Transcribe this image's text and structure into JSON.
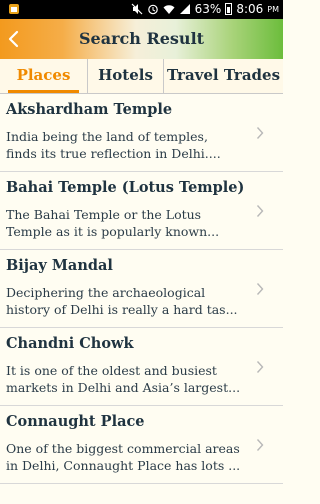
{
  "status_bar": {
    "battery": "63%",
    "time": "8:06",
    "ampm": "PM",
    "icons": [
      "notification-icon",
      "mute-icon",
      "alarm-icon",
      "wifi-icon",
      "signal-icon",
      "battery-icon"
    ]
  },
  "header": {
    "title": "Search Result",
    "back_icon": "chevron-left-icon",
    "gradient_colors": [
      "#f39a1e",
      "#ffffff",
      "#6cbd3c"
    ]
  },
  "tabs": [
    {
      "label": "Places",
      "active": true
    },
    {
      "label": "Hotels",
      "active": false
    },
    {
      "label": "Travel Trades",
      "active": false
    }
  ],
  "accent_color": "#f08a00",
  "items": [
    {
      "title": "Akshardham Temple",
      "line1": "India being the land of temples,",
      "line2": "finds its true reflection in Delhi...."
    },
    {
      "title": "Bahai Temple (Lotus Temple)",
      "line1": "The Bahai Temple or the Lotus",
      "line2": "Temple as it is popularly known..."
    },
    {
      "title": "Bijay Mandal",
      "line1": "Deciphering the archaeological",
      "line2": "history of Delhi is really a hard tas..."
    },
    {
      "title": "Chandni Chowk",
      "line1": "It is one of the oldest and busiest",
      "line2": "markets in Delhi and Asia’s largest..."
    },
    {
      "title": "Connaught Place",
      "line1": "One of the biggest commercial areas",
      "line2": "in Delhi, Connaught Place has lots ..."
    }
  ]
}
